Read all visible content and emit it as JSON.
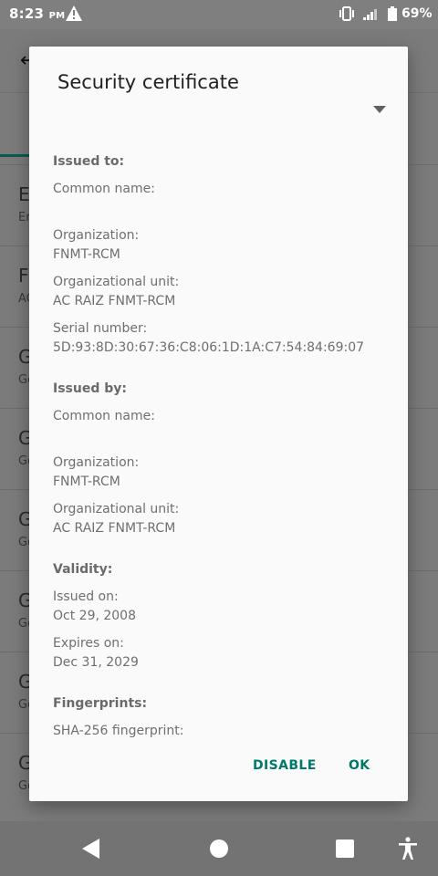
{
  "status_bar": {
    "time": "8:23",
    "ampm": "PM",
    "battery": "69%"
  },
  "background_app": {
    "items": [
      {
        "title": "E",
        "subtitle": "Er"
      },
      {
        "title": "F",
        "subtitle": "AC"
      },
      {
        "title": "G",
        "subtitle": "Go"
      },
      {
        "title": "G",
        "subtitle": "Go"
      },
      {
        "title": "G",
        "subtitle": "Go"
      },
      {
        "title": "G",
        "subtitle": "Go"
      },
      {
        "title": "G",
        "subtitle": "Go"
      },
      {
        "title": "G",
        "subtitle": "Go"
      }
    ]
  },
  "dialog": {
    "title": "Security certificate",
    "issued_to": {
      "heading": "Issued to:",
      "common_name_label": "Common name:",
      "common_name_value": "",
      "organization_label": "Organization:",
      "organization_value": "FNMT-RCM",
      "org_unit_label": "Organizational unit:",
      "org_unit_value": "AC RAIZ FNMT-RCM",
      "serial_label": "Serial number:",
      "serial_value": "5D:93:8D:30:67:36:C8:06:1D:1A:C7:54:84:69:07"
    },
    "issued_by": {
      "heading": "Issued by:",
      "common_name_label": "Common name:",
      "common_name_value": "",
      "organization_label": "Organization:",
      "organization_value": "FNMT-RCM",
      "org_unit_label": "Organizational unit:",
      "org_unit_value": "AC RAIZ FNMT-RCM"
    },
    "validity": {
      "heading": "Validity:",
      "issued_on_label": "Issued on:",
      "issued_on_value": "Oct 29, 2008",
      "expires_on_label": "Expires on:",
      "expires_on_value": "Dec 31, 2029"
    },
    "fingerprints": {
      "heading": "Fingerprints:",
      "sha256_label": "SHA-256 fingerprint:"
    },
    "actions": {
      "disable": "DISABLE",
      "ok": "OK"
    }
  },
  "colors": {
    "accent": "#00796b",
    "dialog_bg": "#fafafa",
    "scrim": "#7b7b7b"
  }
}
